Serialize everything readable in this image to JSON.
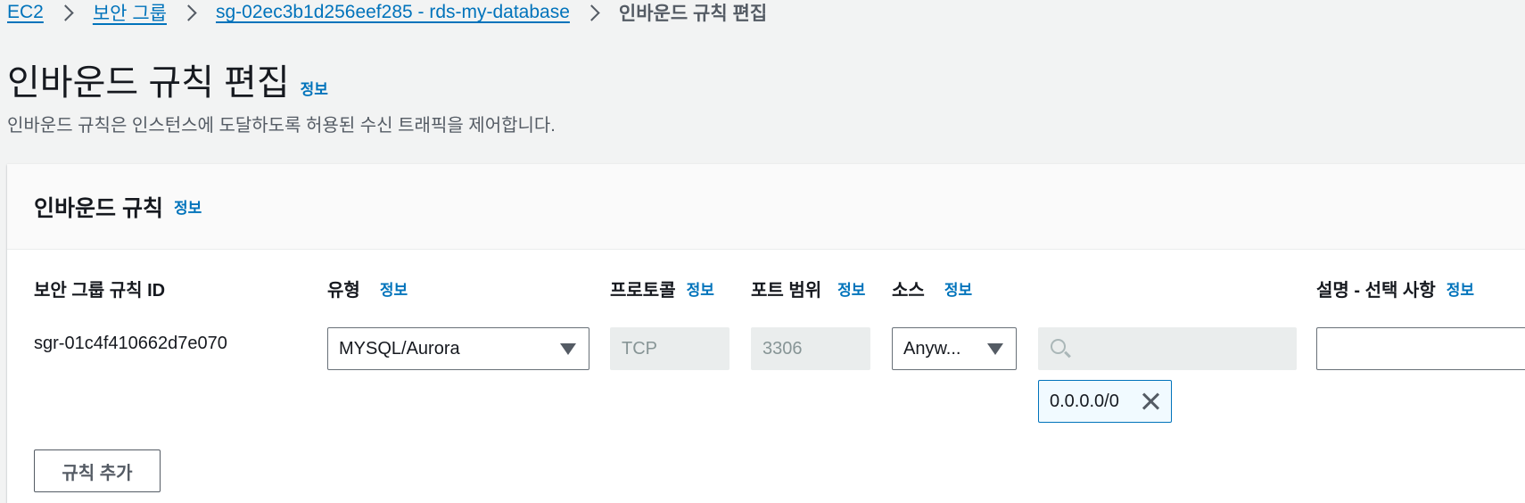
{
  "breadcrumb": {
    "items": [
      "EC2",
      "보안 그룹",
      "sg-02ec3b1d256eef285 - rds-my-database"
    ],
    "current": "인바운드 규칙 편집"
  },
  "page": {
    "title": "인바운드 규칙 편집",
    "info": "정보",
    "description": "인바운드 규칙은 인스턴스에 도달하도록 허용된 수신 트래픽을 제어합니다."
  },
  "panel": {
    "title": "인바운드 규칙",
    "info": "정보",
    "columns": {
      "rule_id": "보안 그룹 규칙 ID",
      "type": "유형",
      "protocol": "프로토콜",
      "port_range": "포트 범위",
      "source": "소스",
      "description": "설명 - 선택 사항"
    },
    "column_info": "정보",
    "rule": {
      "id": "sgr-01c4f410662d7e070",
      "type": "MYSQL/Aurora",
      "protocol": "TCP",
      "port": "3306",
      "source": "Anyw...",
      "cidr": "0.0.0.0/0",
      "description": ""
    },
    "add_rule_label": "규칙 추가"
  }
}
